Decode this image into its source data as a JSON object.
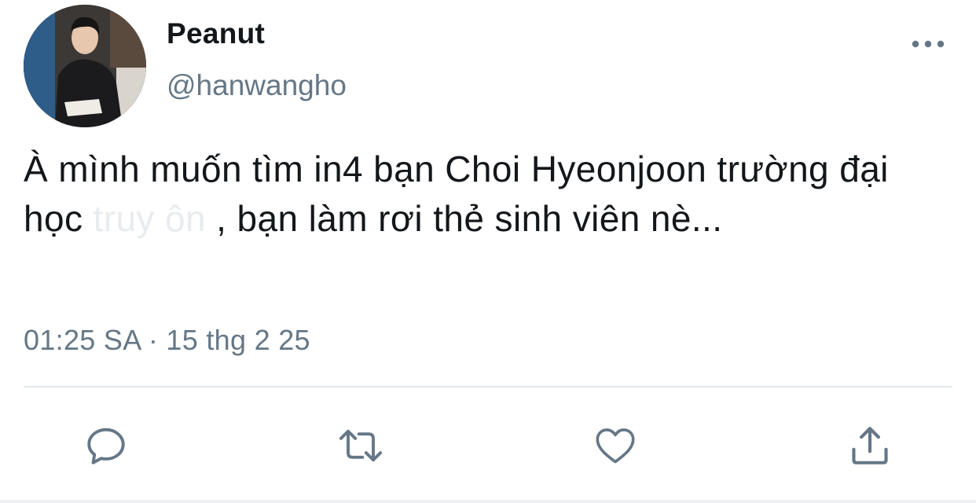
{
  "author": {
    "display_name": "Peanut",
    "handle": "@hanwangho"
  },
  "tweet": {
    "text_part1": "À mình muốn tìm in4 bạn Choi Hyeonjoon trường đại học ",
    "redacted": "truy   ôn  ",
    "text_part2": ", bạn làm rơi thẻ sinh viên nè..."
  },
  "timestamp": "01:25 SA · 15 thg 2 25",
  "icons": {
    "more": "more-horizontal-icon",
    "reply": "reply-icon",
    "retweet": "retweet-icon",
    "like": "heart-icon",
    "share": "share-icon"
  },
  "colors": {
    "text": "#14171a",
    "secondary": "#657786",
    "divider": "#e1e8ed"
  }
}
